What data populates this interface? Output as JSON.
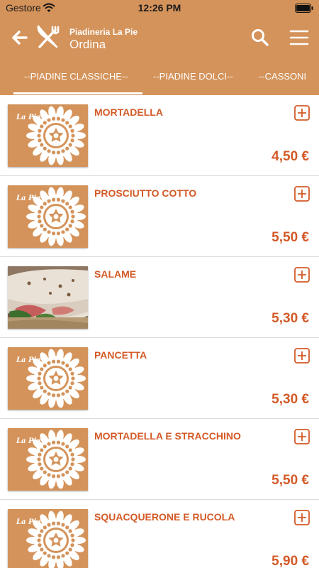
{
  "colors": {
    "header": "#D4935A",
    "accent": "#D35A27",
    "thumb_bg": "#D4935A",
    "divider": "#dcdcdc"
  },
  "status_bar": {
    "carrier": "Gestore",
    "time": "12:26 PM",
    "wifi_icon": "wifi-icon",
    "battery_icon": "battery-icon"
  },
  "header": {
    "subtitle": "Piadineria La Pie",
    "title": "Ordina",
    "back_icon": "arrow-left-icon",
    "logo_icon": "fork-knife-icon",
    "search_icon": "search-icon",
    "menu_icon": "hamburger-menu-icon"
  },
  "tabs": [
    {
      "label": "--PIADINE CLASSICHE--",
      "selected": true
    },
    {
      "label": "--PIADINE DOLCI--",
      "selected": false
    },
    {
      "label": "--CASSONI",
      "selected": false
    }
  ],
  "items": [
    {
      "name": "MORTADELLA",
      "price": "4,50 €",
      "image": "la-pie-logo"
    },
    {
      "name": "PROSCIUTTO COTTO",
      "price": "5,50 €",
      "image": "la-pie-logo"
    },
    {
      "name": "SALAME",
      "price": "5,30 €",
      "image": "piadina-photo"
    },
    {
      "name": "PANCETTA",
      "price": "5,30 €",
      "image": "la-pie-logo"
    },
    {
      "name": "MORTADELLA E STRACCHINO",
      "price": "5,50 €",
      "image": "la-pie-logo"
    },
    {
      "name": "SQUACQUERONE E RUCOLA",
      "price": "5,90 €",
      "image": "la-pie-logo"
    }
  ],
  "logo_text": "La Pie"
}
